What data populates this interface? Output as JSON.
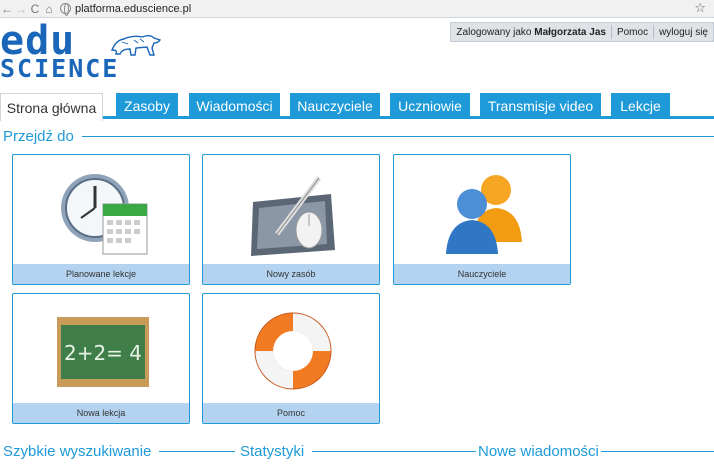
{
  "browser": {
    "url": "platforma.eduscience.pl",
    "back_icon": "back-arrow-icon",
    "forward_icon": "forward-arrow-icon",
    "reload_icon": "reload-icon",
    "home_icon": "home-icon",
    "bookmark_icon": "star-icon"
  },
  "userbar": {
    "logged_prefix": "Zalogowany jako",
    "user_name": "Małgorzata Jas",
    "help": "Pomoc",
    "logout": "wyloguj się"
  },
  "logo": {
    "line1": "edu",
    "line2": "SCIENCE"
  },
  "tabs": [
    "Strona główna",
    "Zasoby",
    "Wiadomości",
    "Nauczyciele",
    "Uczniowie",
    "Transmisje video",
    "Lekcje"
  ],
  "sections": {
    "goto": "Przejdź do",
    "quick_search": "Szybkie wyszukiwanie",
    "stats": "Statystyki",
    "new_messages": "Nowe wiadomości"
  },
  "tiles": [
    {
      "label": "Planowane lekcje",
      "icon": "clock-calendar-icon"
    },
    {
      "label": "Nowy zasób",
      "icon": "tablet-mouse-icon"
    },
    {
      "label": "Nauczyciele",
      "icon": "users-icon"
    },
    {
      "label": "Nowa lekcja",
      "icon": "chalkboard-icon",
      "board_text": "2+2= 4"
    },
    {
      "label": "Pomoc",
      "icon": "lifebuoy-icon"
    }
  ],
  "colors": {
    "accent": "#1e9ad8",
    "brand": "#1a66b8",
    "tile_caption": "#b3d3f1"
  }
}
